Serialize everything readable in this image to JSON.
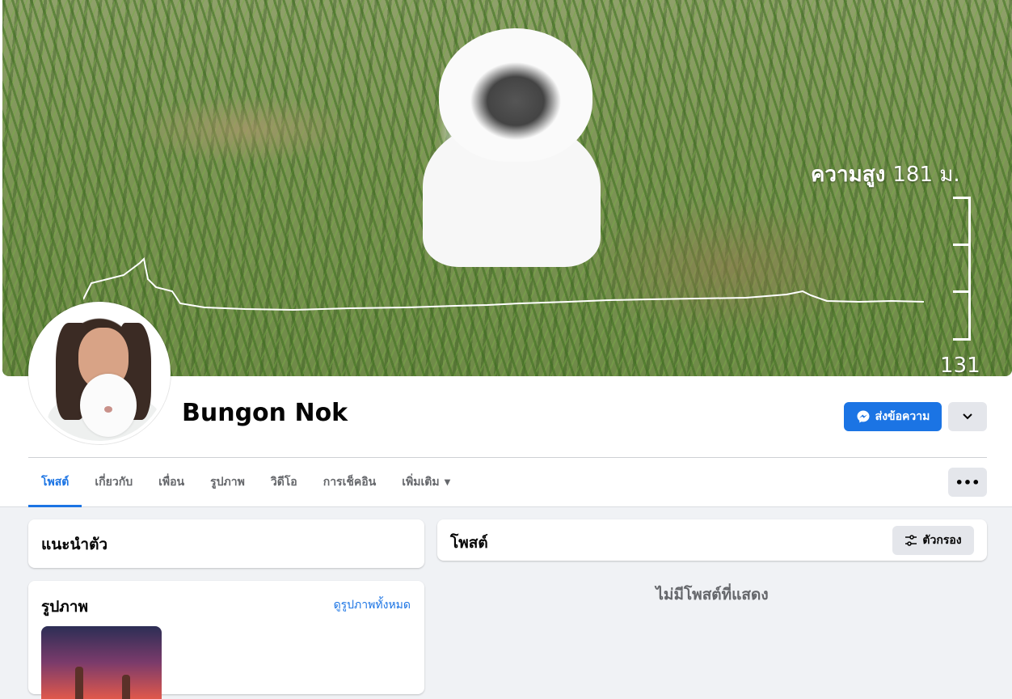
{
  "cover": {
    "altitude_label": "ความสูง",
    "altitude_value": "181 ม.",
    "altitude_min": "131"
  },
  "profile": {
    "name": "Bungon Nok",
    "message_button": "ส่งข้อความ"
  },
  "tabs": [
    {
      "label": "โพสต์",
      "active": true
    },
    {
      "label": "เกี่ยวกับ"
    },
    {
      "label": "เพื่อน"
    },
    {
      "label": "รูปภาพ"
    },
    {
      "label": "วิดีโอ"
    },
    {
      "label": "การเช็คอิน"
    },
    {
      "label": "เพิ่มเติม"
    }
  ],
  "intro": {
    "title": "แนะนำตัว"
  },
  "photos": {
    "title": "รูปภาพ",
    "see_all": "ดูรูปภาพทั้งหมด"
  },
  "posts": {
    "title": "โพสต์",
    "filter_button": "ตัวกรอง",
    "empty_text": "ไม่มีโพสต์ที่แสดง"
  },
  "colors": {
    "accent": "#1b74e4",
    "page_bg": "#f0f2f5",
    "secondary_button": "#e4e6eb",
    "muted_text": "#65676b"
  },
  "icons": {
    "message": "messenger-icon",
    "dropdown": "chevron-down-icon",
    "more": "more-dots-icon",
    "filter": "filter-sliders-icon"
  }
}
